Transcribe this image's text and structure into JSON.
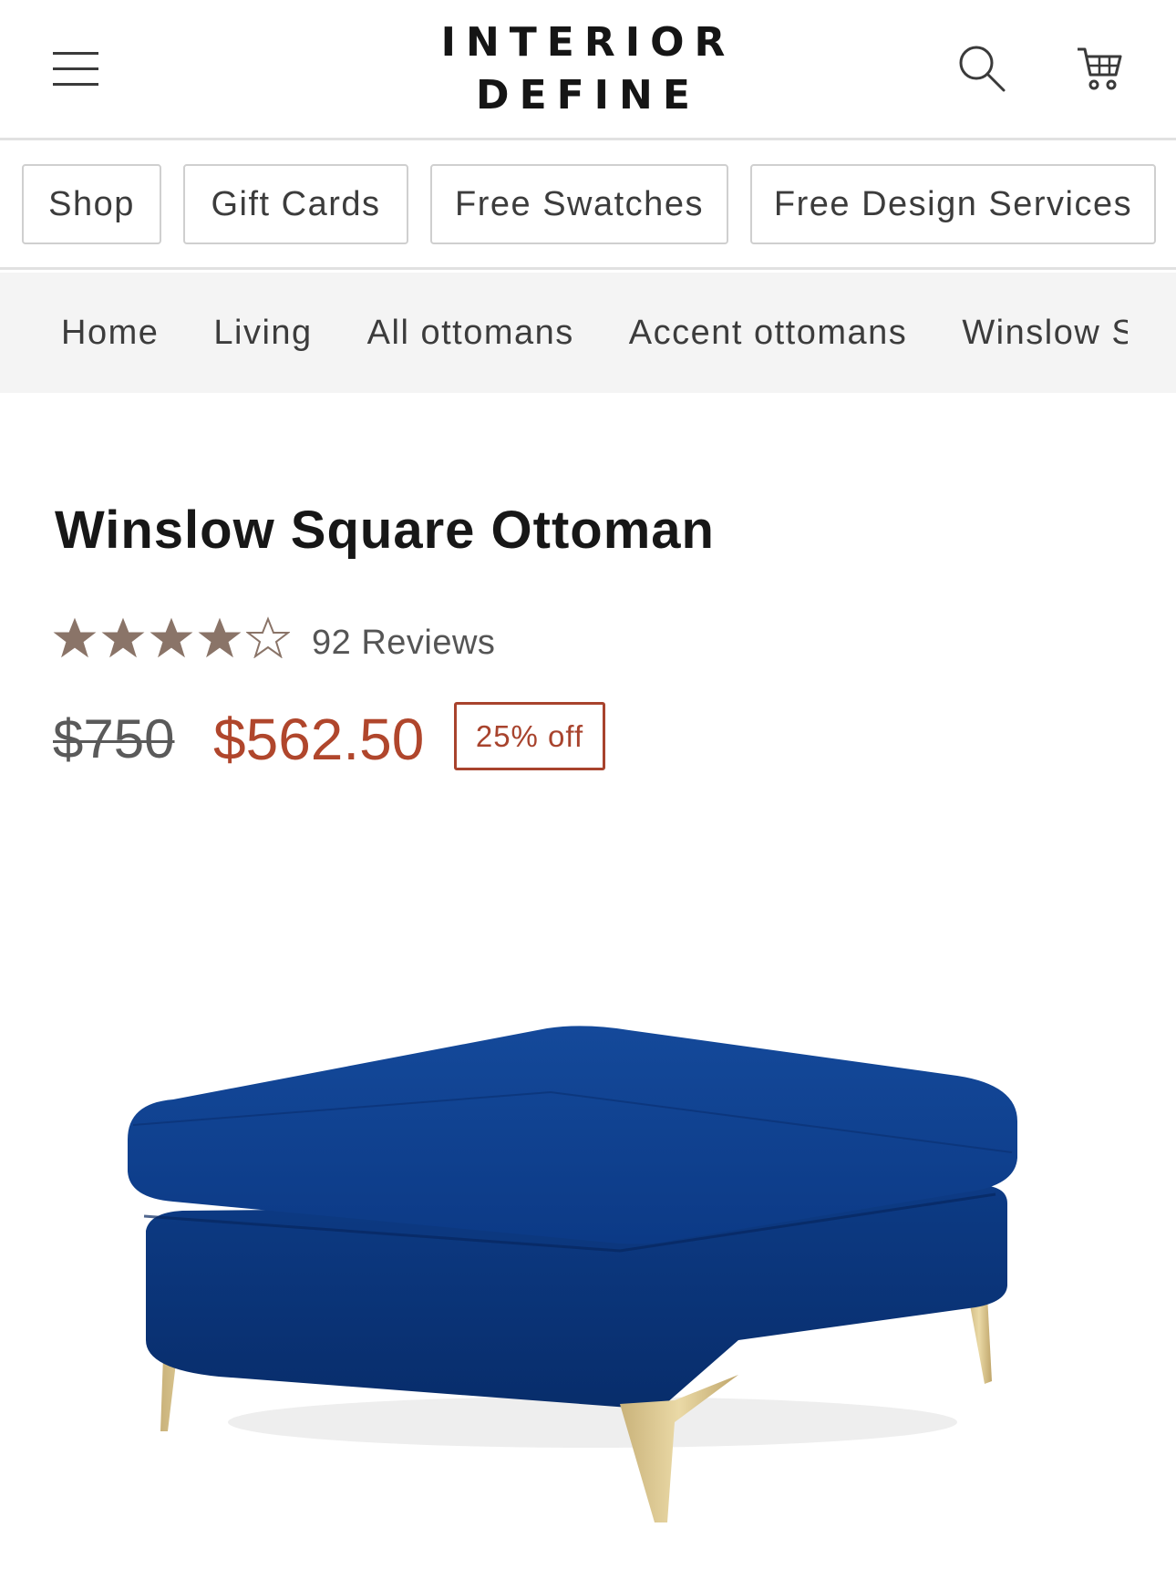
{
  "header": {
    "logo_line1": "INTERIOR",
    "logo_line2": "DEFINE",
    "menu_icon": "hamburger-menu-icon",
    "search_icon": "search-icon",
    "cart_icon": "shopping-cart-icon"
  },
  "nav": {
    "pills": [
      "Shop",
      "Gift Cards",
      "Free Swatches",
      "Free Design Services"
    ]
  },
  "breadcrumb": {
    "items": [
      "Home",
      "Living",
      "All ottomans",
      "Accent ottomans",
      "Winslow Square Ottoman"
    ],
    "separator_icon": "chevron-right-icon"
  },
  "product": {
    "title": "Winslow Square Ottoman",
    "rating": 4,
    "rating_max": 5,
    "reviews_label": "92 Reviews",
    "original_price": "$750",
    "sale_price": "$562.50",
    "discount_badge": "25% off"
  },
  "colors": {
    "star": "#8a7468",
    "sale_price": "#b0462c",
    "badge": "#a8432d",
    "ottoman_fabric": "#0e3d8a",
    "legs": "#d8c38c",
    "breadcrumb_bg": "#f4f4f4"
  }
}
